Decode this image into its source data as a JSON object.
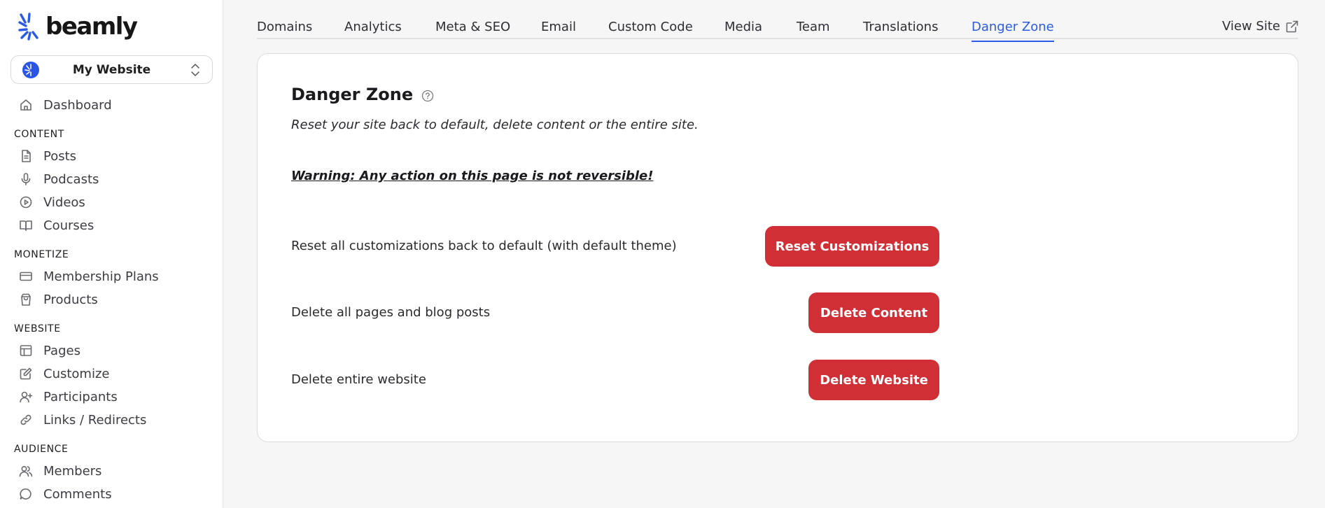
{
  "app": {
    "name": "beamly"
  },
  "site_switcher": {
    "name": "My Website"
  },
  "sidebar": {
    "dashboard": "Dashboard",
    "sections": {
      "content": "CONTENT",
      "monetize": "MONETIZE",
      "website": "WEBSITE",
      "audience": "AUDIENCE"
    },
    "items": {
      "posts": "Posts",
      "podcasts": "Podcasts",
      "videos": "Videos",
      "courses": "Courses",
      "membership_plans": "Membership Plans",
      "products": "Products",
      "pages": "Pages",
      "customize": "Customize",
      "participants": "Participants",
      "links_redirects": "Links / Redirects",
      "members": "Members",
      "comments": "Comments"
    }
  },
  "tabs": {
    "domains": "Domains",
    "analytics": "Analytics",
    "meta_seo": "Meta & SEO",
    "email": "Email",
    "custom_code": "Custom Code",
    "media": "Media",
    "team": "Team",
    "translations": "Translations",
    "danger_zone": "Danger Zone",
    "active": "Danger Zone"
  },
  "view_site": "View Site",
  "danger": {
    "title": "Danger Zone",
    "description": "Reset your site back to default, delete content or the entire site.",
    "warning": "Warning: Any action on this page is not reversible!",
    "rows": {
      "reset": {
        "label": "Reset all customizations back to default (with default theme)",
        "button": "Reset Customizations"
      },
      "content": {
        "label": "Delete all pages and blog posts",
        "button": "Delete Content"
      },
      "website": {
        "label": "Delete entire website",
        "button": "Delete Website"
      }
    }
  },
  "colors": {
    "accent": "#2b5be6",
    "danger": "#cf2f35",
    "background": "#f6f6f7"
  }
}
